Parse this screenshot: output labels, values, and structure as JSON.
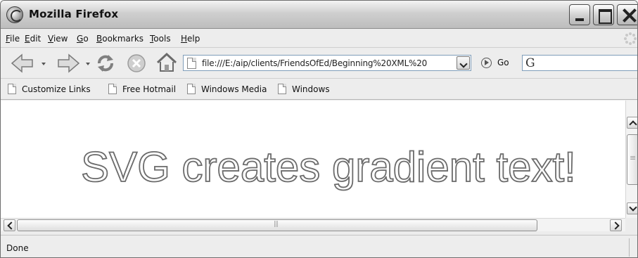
{
  "window": {
    "title": "Mozilla Firefox"
  },
  "menu": {
    "items": [
      {
        "accel": "F",
        "rest": "ile"
      },
      {
        "accel": "E",
        "rest": "dit"
      },
      {
        "accel": "V",
        "rest": "iew"
      },
      {
        "accel": "G",
        "rest": "o"
      },
      {
        "accel": "B",
        "rest": "ookmarks"
      },
      {
        "accel": "T",
        "rest": "ools"
      },
      {
        "accel": "H",
        "rest": "elp"
      }
    ]
  },
  "navigation": {
    "url": "file:///E:/aip/clients/FriendsOfEd/Beginning%20XML%20",
    "go_label": "Go",
    "search_value": ""
  },
  "bookmarks": {
    "items": [
      "Customize Links",
      "Free Hotmail",
      "Windows Media",
      "Windows"
    ]
  },
  "content": {
    "heading": "SVG creates gradient text!"
  },
  "status": {
    "text": "Done"
  }
}
